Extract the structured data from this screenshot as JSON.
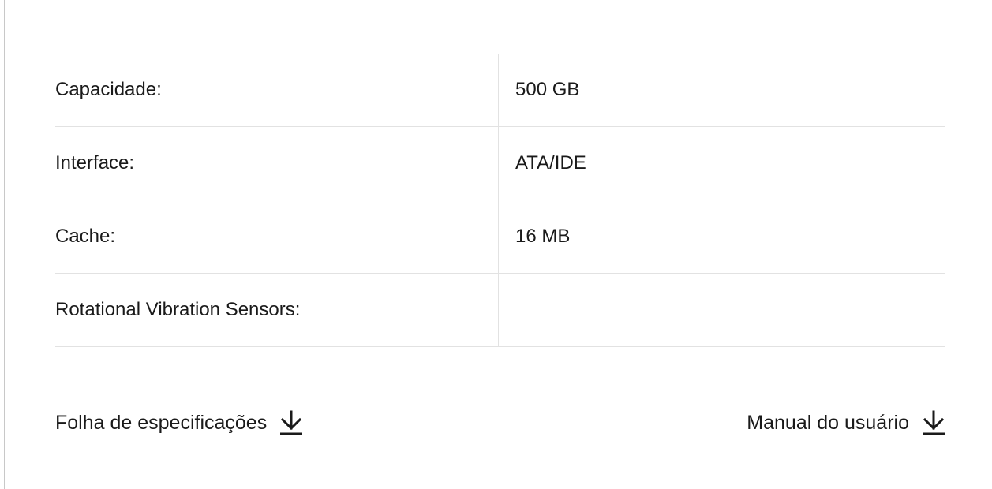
{
  "specs": [
    {
      "label": "Capacidade:",
      "value": "500 GB"
    },
    {
      "label": "Interface:",
      "value": "ATA/IDE"
    },
    {
      "label": "Cache:",
      "value": "16 MB"
    },
    {
      "label": "Rotational Vibration Sensors:",
      "value": ""
    }
  ],
  "downloads": {
    "datasheet_label": "Folha de especificações",
    "manual_label": "Manual do usuário",
    "icon": "download-arrow-icon"
  }
}
